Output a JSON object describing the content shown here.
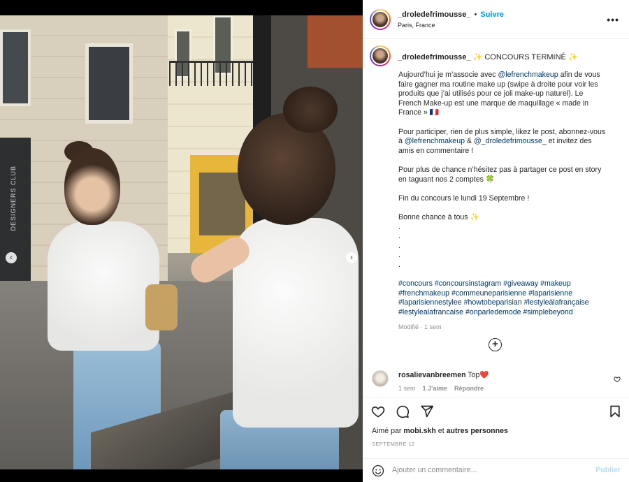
{
  "post": {
    "username": "_droledefrimousse_",
    "separator": "•",
    "follow_label": "Suivre",
    "location": "Paris, France",
    "more_icon": "more-options-icon"
  },
  "caption": {
    "title_username": "_droledefrimousse_",
    "title_text": "✨ CONCOURS TERMINÉ ✨",
    "p1_a": "Aujourd’hui je m’associe avec ",
    "p1_mention": "@lefrenchmakeup",
    "p1_b": " afin de vous faire gagner ma routine make up (swipe à droite pour voir les produits que j’ai utilisés pour ce joli make-up naturel). Le French Make-up est une marque de maquillage « made in France » 🇫🇷",
    "p2_a": "Pour participer, rien de plus simple, likez le post, abonnez-vous à ",
    "p2_mention1": "@lefrenchmakeup",
    "p2_b": " & ",
    "p2_mention2": "@_droledefrimousse_",
    "p2_c": " et invitez des amis en commentaire !",
    "p3": "Pour plus de chance n’hésitez pas à partager ce post en story en taguant nos 2 comptes 🍀",
    "p4": "Fin du concours le lundi 19 Septembre !",
    "p5": "Bonne chance à tous ✨",
    "dots": [
      ".",
      ".",
      ".",
      ".",
      "."
    ],
    "hashtags": "#concours #concoursinstagram #giveaway #makeup #frenchmakeup #commeuneparisienne #laparisienne #laparisiennestylee #howtobeparisian #lestyleàlafrançaise #lestylealafrancaise #onparledemode #simplebeyond",
    "meta": "Modifié · 1 sem",
    "add_icon": "add-circle-icon"
  },
  "comment": {
    "username": "rosalievanbreemen",
    "text": "Top❤️",
    "time": "1 sem",
    "likes": "1 J’aime",
    "reply": "Répondre"
  },
  "actions": {
    "liked_by_prefix": "Aimé par ",
    "liked_by_user": "mobi.skh",
    "liked_by_mid": " et ",
    "liked_by_others": "autres personnes",
    "date": "SEPTEMBRE 12"
  },
  "add_comment": {
    "placeholder": "Ajouter un commentaire...",
    "publish": "Publier"
  },
  "carousel": {
    "prev": "‹",
    "next": "›",
    "dot_count": 6,
    "active_index": 1
  },
  "photo_text": {
    "shop_sign": "DESIGNERS CLUB"
  },
  "colors": {
    "link_blue": "#0095f6",
    "mention_blue": "#00376b",
    "muted": "#8e8e8e",
    "publish_disabled": "#b2dffc"
  }
}
